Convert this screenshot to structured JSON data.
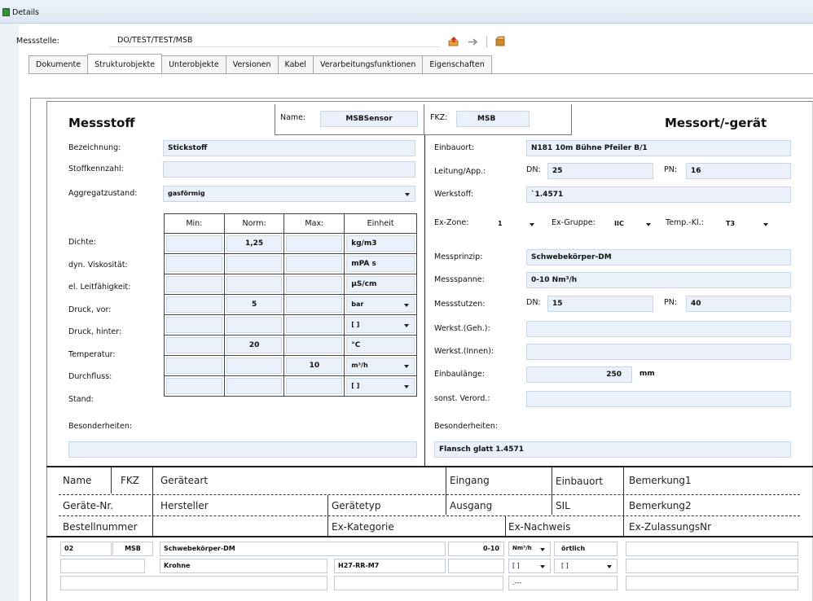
{
  "window": {
    "title": "Details"
  },
  "messstelle": {
    "label": "Messstelle:",
    "value": "DO/TEST/TEST/MSB"
  },
  "toolbar": {
    "icons": [
      "export-icon",
      "arrow-right-icon",
      "package-icon"
    ]
  },
  "tabs": [
    "Dokumente",
    "Strukturobjekte",
    "Unterobjekte",
    "Versionen",
    "Kabel",
    "Verarbeitungsfunktionen",
    "Eigenschaften"
  ],
  "active_tab": "Strukturobjekte",
  "header": {
    "left_title": "Messstoff",
    "right_title": "Messort/-gerät",
    "name_label": "Name:",
    "name_value": "MSBSensor",
    "fkz_label": "FKZ:",
    "fkz_value": "MSB"
  },
  "left": {
    "bezeichnung_label": "Bezeichnung:",
    "bezeichnung_value": "Stickstoff",
    "stoffkennzahl_label": "Stoffkennzahl:",
    "stoffkennzahl_value": "",
    "aggregat_label": "Aggregatzustand:",
    "aggregat_value": "gasförmig",
    "columns": [
      "Min:",
      "Norm:",
      "Max:",
      "Einheit"
    ],
    "rows": [
      {
        "label": "Dichte:",
        "min": "",
        "norm": "1,25",
        "max": "",
        "unit": "kg/m3",
        "dropdown": false
      },
      {
        "label": "dyn. Viskosität:",
        "min": "",
        "norm": "",
        "max": "",
        "unit": "mPA s",
        "dropdown": false
      },
      {
        "label": "el. Leitfähigkeit:",
        "min": "",
        "norm": "",
        "max": "",
        "unit": "µS/cm",
        "dropdown": false
      },
      {
        "label": "Druck, vor:",
        "min": "",
        "norm": "5",
        "max": "",
        "unit": "bar",
        "dropdown": true
      },
      {
        "label": "Druck, hinter:",
        "min": "",
        "norm": "",
        "max": "",
        "unit": "[ ]",
        "dropdown": true
      },
      {
        "label": "Temperatur:",
        "min": "",
        "norm": "20",
        "max": "",
        "unit": "°C",
        "dropdown": false
      },
      {
        "label": "Durchfluss:",
        "min": "",
        "norm": "",
        "max": "10",
        "unit": "m³/h",
        "dropdown": true
      },
      {
        "label": "Stand:",
        "min": "",
        "norm": "",
        "max": "",
        "unit": "[ ]",
        "dropdown": true
      }
    ],
    "besonderheiten_label": "Besonderheiten:",
    "besonderheiten_value": ""
  },
  "right": {
    "einbauort_label": "Einbauort:",
    "einbauort_value": "N181 10m Bühne Pfeiler B/1",
    "leitung_label": "Leitung/App.:",
    "dn_label": "DN:",
    "leitung_dn": "25",
    "pn_label": "PN:",
    "leitung_pn": "16",
    "werkstoff_label": "Werkstoff:",
    "werkstoff_value": "`1.4571",
    "exzone_label": "Ex-Zone:",
    "exzone_value": "1",
    "exgruppe_label": "Ex-Gruppe:",
    "exgruppe_value": "IIC",
    "tempkl_label": "Temp.-Kl.:",
    "tempkl_value": "T3",
    "messprinzip_label": "Messprinzip:",
    "messprinzip_value": "Schwebekörper-DM",
    "messspanne_label": "Messspanne:",
    "messspanne_value": "0-10 Nm³/h",
    "messstutzen_label": "Messstutzen:",
    "messstutzen_dn": "15",
    "messstutzen_pn": "40",
    "werkstgeh_label": "Werkst.(Geh.):",
    "werkstgeh_value": "",
    "werkstinnen_label": "Werkst.(Innen):",
    "werkstinnen_value": "",
    "einbaulaenge_label": "Einbaulänge:",
    "einbaulaenge_value": "250",
    "einbaulaenge_unit": "mm",
    "sonst_label": "sonst. Verord.:",
    "sonst_value": "",
    "besonderheiten_label": "Besonderheiten:",
    "besonderheiten_value": "Flansch glatt 1.4571"
  },
  "bottom": {
    "headers": {
      "name": "Name",
      "fkz": "FKZ",
      "geraeteart": "Geräteart",
      "eingang": "Eingang",
      "einbauort": "Einbauort",
      "bemerkung1": "Bemerkung1",
      "geraetenr": "Geräte-Nr.",
      "hersteller": "Hersteller",
      "geraetetyp": "Gerätetyp",
      "ausgang": "Ausgang",
      "sil": "SIL",
      "bemerkung2": "Bemerkung2",
      "bestellnummer": "Bestellnummer",
      "exkategorie": "Ex-Kategorie",
      "exnachweis": "Ex-Nachweis",
      "exzulassung": "Ex-ZulassungsNr"
    },
    "row1": {
      "name": "02",
      "fkz": "MSB",
      "geraeteart": "Schwebekörper-DM",
      "eingang": "0-10",
      "eingang_unit": "Nm³/h",
      "einbauort": "örtlich"
    },
    "row2": {
      "hersteller": "Krohne",
      "geraetetyp": "H27-RR-M7",
      "ausgang_unit": "[ ]",
      "sil": "[ ]"
    },
    "row3": {
      "exnachweis": ".---"
    }
  }
}
